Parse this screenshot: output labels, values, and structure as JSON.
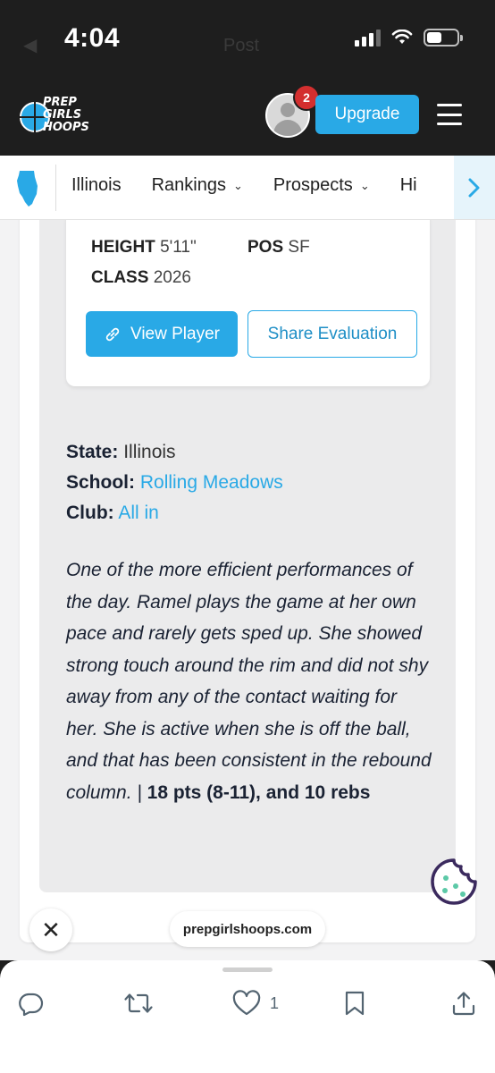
{
  "status_bar": {
    "time": "4:04",
    "back_ghost": "◀",
    "ghost_title": "Post"
  },
  "header": {
    "logo": [
      "PREP",
      "GIRLS",
      "HOOPS"
    ],
    "notification_count": "2",
    "upgrade_label": "Upgrade"
  },
  "nav": {
    "items": [
      {
        "label": "Illinois",
        "dropdown": false
      },
      {
        "label": "Rankings",
        "dropdown": true
      },
      {
        "label": "Prospects",
        "dropdown": true
      },
      {
        "label": "Hi",
        "dropdown": false
      }
    ]
  },
  "player": {
    "height_label": "HEIGHT",
    "height_value": "5'11\"",
    "pos_label": "POS",
    "pos_value": "SF",
    "class_label": "CLASS",
    "class_value": "2026",
    "view_button": "View Player",
    "share_button": "Share Evaluation"
  },
  "details": {
    "state_label": "State:",
    "state_value": "Illinois",
    "school_label": "School:",
    "school_value": "Rolling Meadows",
    "club_label": "Club:",
    "club_value": "All in"
  },
  "evaluation": {
    "text": "One of the more efficient performances of the day. Ramel plays the game at her own pace and rarely gets sped up. She showed strong touch around the rim and did not shy away from any of the contact waiting for her. She is active when she is off the ball, and that has been consistent in the rebound column. | ",
    "stats": "18 pts (8-11), and 10 rebs"
  },
  "browser": {
    "close_symbol": "✕",
    "domain": "prepgirlshoops.com"
  },
  "tweet_actions": {
    "like_count": "1"
  },
  "colors": {
    "accent": "#29a9e6",
    "header_bg": "#1e1e1e",
    "badge": "#d32f2f",
    "cookie": "#3b2a5e"
  }
}
